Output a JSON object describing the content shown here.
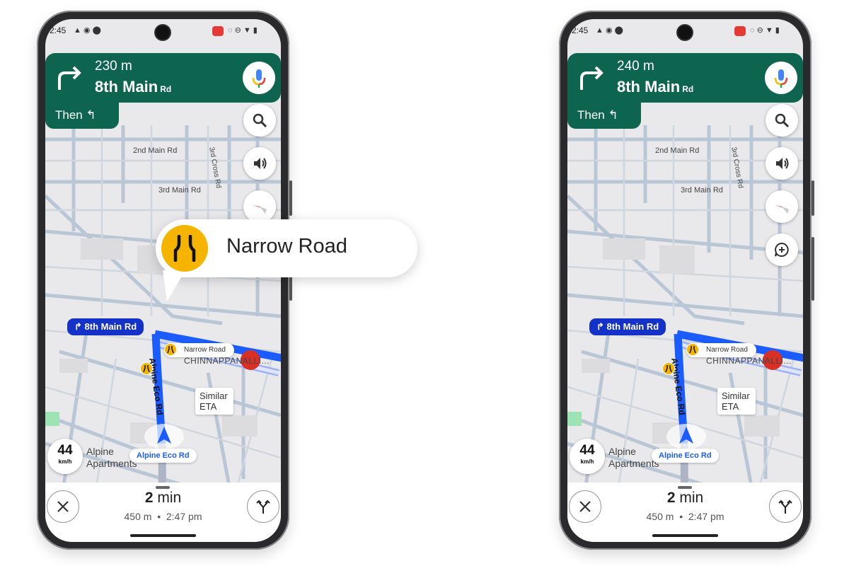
{
  "callout": {
    "label": "Narrow Road",
    "icon": "narrow-road-icon",
    "color": "#f5b400"
  },
  "colors": {
    "banner": "#0d6550",
    "route": "#1a5cff",
    "route_label": "#1432c8"
  },
  "phones": [
    {
      "status": {
        "time": "2:45"
      },
      "banner": {
        "distance": "230 m",
        "street": "8th Main",
        "suffix": "Rd",
        "then": "Then"
      },
      "map_labels": {
        "road1": "2nd Main Rd",
        "road2": "3rd Main Rd",
        "road3": "3rd Cross Rd",
        "area": "CHINNAPPANALLI...",
        "poi": "Alpine Apartments",
        "eta": "Similar ETA"
      },
      "route_label": "8th Main Rd",
      "hazard_label": "Narrow Road",
      "current_road": "Alpine Eco Rd",
      "vertical_road": "Alpine Eco Rd",
      "speed": {
        "value": "44",
        "unit": "km/h"
      },
      "trip": {
        "duration_num": "2",
        "duration_unit": "min",
        "distance": "450 m",
        "separator": "•",
        "arrival": "2:47 pm"
      },
      "report_button": false
    },
    {
      "status": {
        "time": "2:45"
      },
      "banner": {
        "distance": "240 m",
        "street": "8th Main",
        "suffix": "Rd",
        "then": "Then"
      },
      "map_labels": {
        "road1": "2nd Main Rd",
        "road2": "3rd Main Rd",
        "road3": "3rd Cross Rd",
        "area": "CHINNAPPANALLI...",
        "poi": "Alpine Apartments",
        "eta": "Similar ETA"
      },
      "route_label": "8th Main Rd",
      "hazard_label": "Narrow Road",
      "current_road": "Alpine Eco Rd",
      "vertical_road": "Alpine Eco Rd",
      "speed": {
        "value": "44",
        "unit": "km/h"
      },
      "trip": {
        "duration_num": "2",
        "duration_unit": "min",
        "distance": "450 m",
        "separator": "•",
        "arrival": "2:47 pm"
      },
      "report_button": true
    }
  ]
}
